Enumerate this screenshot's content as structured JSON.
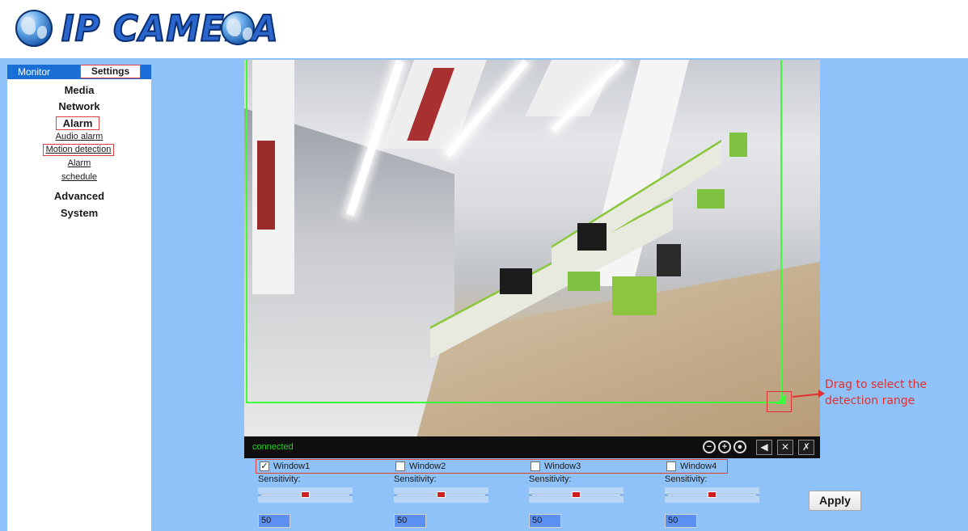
{
  "header": {
    "brand": "IP CAMERA"
  },
  "sidebar": {
    "tabs": {
      "monitor": "Monitor",
      "settings": "Settings"
    },
    "groups": {
      "media": "Media",
      "network": "Network",
      "alarm": "Alarm",
      "advanced": "Advanced",
      "system": "System"
    },
    "alarm_items": [
      "Audio alarm",
      "Motion detection",
      "Alarm",
      "schedule"
    ]
  },
  "video": {
    "status": "connected",
    "controls": [
      "zoom-out",
      "zoom-in",
      "record",
      "mute",
      "mic-off",
      "settings"
    ]
  },
  "annotation": {
    "text": "Drag to select the detection range"
  },
  "windows": [
    {
      "label": "Window1",
      "checked": true,
      "sensitivity_label": "Sensitivity:",
      "value": "50",
      "level": 0.5
    },
    {
      "label": "Window2",
      "checked": false,
      "sensitivity_label": "Sensitivity:",
      "value": "50",
      "level": 0.5
    },
    {
      "label": "Window3",
      "checked": false,
      "sensitivity_label": "Sensitivity:",
      "value": "50",
      "level": 0.5
    },
    {
      "label": "Window4",
      "checked": false,
      "sensitivity_label": "Sensitivity:",
      "value": "50",
      "level": 0.5
    }
  ],
  "apply_label": "Apply",
  "colors": {
    "page_bg": "#8ec2f8",
    "nav_bar": "#1a6fd6",
    "highlight_border": "#e04040",
    "detect_area": "#3cff3c",
    "status_text": "#23d423"
  }
}
